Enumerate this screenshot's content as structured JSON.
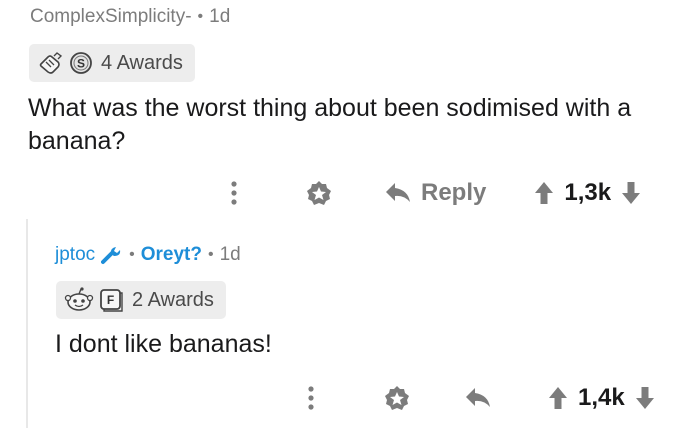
{
  "comment": {
    "author": "ComplexSimplicity-",
    "separator": "•",
    "age": "1d",
    "awards_label": "4 Awards",
    "award_icons": [
      "pointing-hand-award-icon",
      "silver-coin-award-icon"
    ],
    "body_lines": [
      "What was the worst thing about been sodimised with a",
      "banana?"
    ],
    "actions": {
      "more_icon": "vertical-ellipsis-icon",
      "give_award_icon": "award-badge-icon",
      "reply_label": "Reply",
      "score": "1,3k"
    }
  },
  "reply": {
    "author": "jptoc",
    "flair_icon": "wrench-icon",
    "separator": "•",
    "flair": "Oreyt?",
    "age": "1d",
    "awards_label": "2 Awards",
    "award_icons": [
      "snoo-award-icon",
      "press-f-award-icon"
    ],
    "body": "I dont like bananas!",
    "actions": {
      "more_icon": "vertical-ellipsis-icon",
      "give_award_icon": "award-badge-icon",
      "reply_icon": "reply-arrow-icon",
      "score": "1,4k"
    }
  },
  "colors": {
    "username": "#1e8ed8",
    "meta_gray": "#7c7c7c",
    "awards_bg": "#ededed",
    "text": "#1a1a1b",
    "thread_line": "#e8e8e8"
  }
}
